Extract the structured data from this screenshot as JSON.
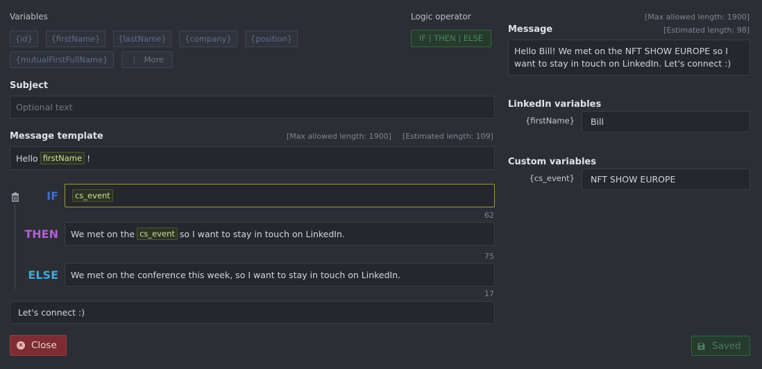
{
  "variables": {
    "label": "Variables",
    "chips": [
      "{id}",
      "{firstName}",
      "{lastName}",
      "{company}",
      "{position}",
      "{mutualFirstFullName}"
    ],
    "more_label": "More"
  },
  "logic": {
    "label": "Logic operator",
    "button_label": "IF | THEN | ELSE"
  },
  "subject": {
    "label": "Subject",
    "placeholder": "Optional text"
  },
  "template": {
    "label": "Message template",
    "max_note": "[Max allowed length: 1900]",
    "est_note": "[Estimated length: 109]",
    "line_prefix": "Hello",
    "line_tag": "firstName",
    "line_suffix": "!"
  },
  "condition": {
    "if_kw": "IF",
    "if_tag": "cs_event",
    "if_count": "62",
    "then_kw": "THEN",
    "then_prefix": "We met on the",
    "then_tag": "cs_event",
    "then_suffix": "so I want to stay in touch on LinkedIn.",
    "then_count": "75",
    "else_kw": "ELSE",
    "else_text": "We met on the conference this week, so I want to stay in touch on LinkedIn.",
    "else_count": "17"
  },
  "footer_line": "Let's connect :)",
  "message": {
    "label": "Message",
    "max_note": "[Max allowed length: 1900]",
    "est_note": "[Estimated length: 98]",
    "text": "Hello Bill! We met on the NFT SHOW EUROPE so I want to stay in touch on LinkedIn. Let's connect :)"
  },
  "linkedin_vars": {
    "label": "LinkedIn variables",
    "key": "{firstName}",
    "value": "Bill"
  },
  "custom_vars": {
    "label": "Custom variables",
    "key": "{cs_event}",
    "value": "NFT SHOW EUROPE"
  },
  "buttons": {
    "close": "Close",
    "saved": "Saved"
  },
  "colors": {
    "if": "#3d6fd6",
    "then": "#b35fd8",
    "else": "#48a6d8",
    "close_bg": "#7d2d31",
    "saved_bg": "#263a2e"
  }
}
